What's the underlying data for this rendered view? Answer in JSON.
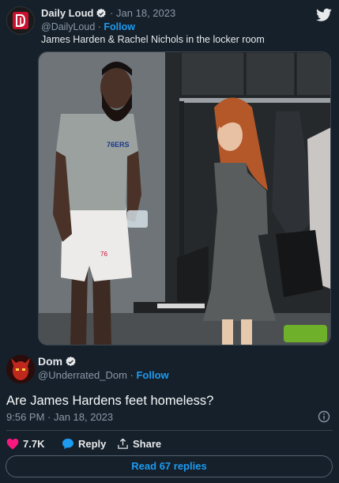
{
  "quoted": {
    "name": "Daily Loud",
    "date": "Jan 18, 2023",
    "handle": "@DailyLoud",
    "follow_label": "Follow",
    "text": "James Harden & Rachel Nichols in the locker room",
    "jersey_text": "76ERS",
    "shorts_number": "76"
  },
  "reply": {
    "name": "Dom",
    "handle": "@Underrated_Dom",
    "follow_label": "Follow",
    "text": "Are James Hardens feet homeless?",
    "timestamp": "9:56 PM · Jan 18, 2023",
    "likes_count": "7.7K",
    "reply_label": "Reply",
    "share_label": "Share",
    "read_replies_label": "Read 67 replies"
  },
  "icons": {
    "bird": "twitter-bird-icon",
    "verified": "verified-badge-icon",
    "heart": "heart-icon",
    "reply": "reply-bubble-icon",
    "share": "share-icon",
    "info": "info-icon"
  },
  "colors": {
    "background": "#15202b",
    "accent": "#1d9bf0",
    "like": "#f91880",
    "muted": "#8b98a5",
    "text": "#f7f9f9"
  }
}
